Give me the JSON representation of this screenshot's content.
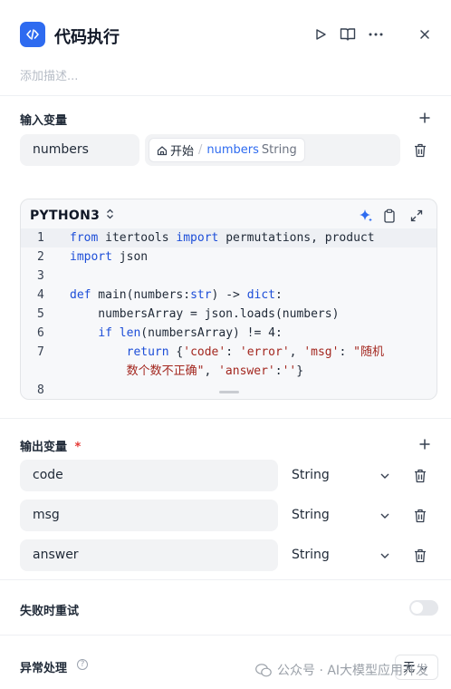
{
  "header": {
    "title": "代码执行",
    "description_placeholder": "添加描述..."
  },
  "inputs": {
    "title": "输入变量",
    "var_name": "numbers",
    "ref_node": "开始",
    "ref_sep": "/",
    "ref_var": "numbers",
    "ref_type": "String"
  },
  "editor": {
    "language": "PYTHON3",
    "lines": [
      {
        "n": "1"
      },
      {
        "n": "2"
      },
      {
        "n": "3"
      },
      {
        "n": "4"
      },
      {
        "n": "5"
      },
      {
        "n": "6"
      },
      {
        "n": "7"
      },
      {
        "n": ""
      },
      {
        "n": "8"
      }
    ],
    "code": {
      "l1_a": "from",
      "l1_b": " itertools ",
      "l1_c": "import",
      "l1_d": " permutations, product",
      "l2_a": "import",
      "l2_b": " json",
      "l4_a": "def",
      "l4_b": " main(numbers:",
      "l4_c": "str",
      "l4_d": ") -> ",
      "l4_e": "dict",
      "l4_f": ":",
      "l5_a": "    numbersArray = json.loads(numbers)",
      "l6_a": "    ",
      "l6_b": "if",
      "l6_c": " ",
      "l6_d": "len",
      "l6_e": "(numbersArray) != 4:",
      "l7_a": "        ",
      "l7_b": "return",
      "l7_c": " {",
      "l7_d": "'code'",
      "l7_e": ": ",
      "l7_f": "'error'",
      "l7_g": ", ",
      "l7_h": "'msg'",
      "l7_i": ": ",
      "l7_j": "\"随机",
      "l7w_a": "        ",
      "l7w_b": "数个数不正确\"",
      "l7w_c": ", ",
      "l7w_d": "'answer'",
      "l7w_e": ":",
      "l7w_f": "''",
      "l7w_g": "}"
    }
  },
  "outputs": {
    "title": "输出变量",
    "required_mark": "*",
    "items": [
      {
        "name": "code",
        "type": "String"
      },
      {
        "name": "msg",
        "type": "String"
      },
      {
        "name": "answer",
        "type": "String"
      }
    ]
  },
  "retry": {
    "label": "失败时重试",
    "enabled": false
  },
  "error_handling": {
    "label": "异常处理",
    "help": "?",
    "value": "无"
  },
  "watermark": {
    "text": "公众号 · AI大模型应用开发"
  },
  "colors": {
    "accent": "#2e6bf0",
    "keyword": "#1d4ed8",
    "string": "#a3271f",
    "required": "#e53935"
  }
}
